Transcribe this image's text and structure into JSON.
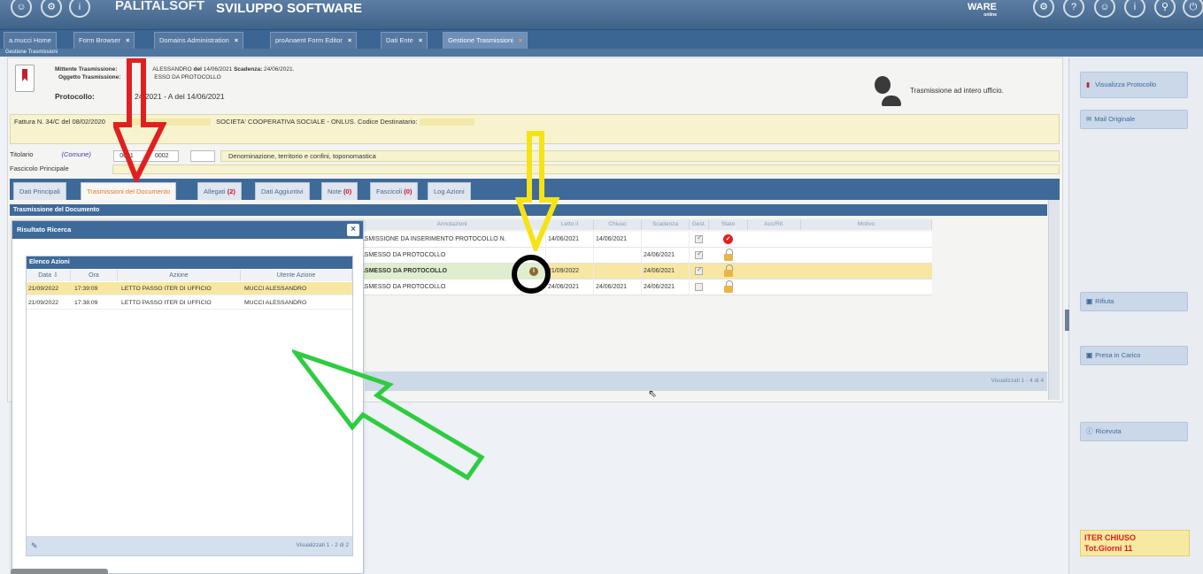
{
  "header": {
    "app_name": "SVILUPPO SOFTWARE",
    "app_name_left": "PALITALSOFT",
    "logo": "WARE",
    "logo_sub": "online"
  },
  "tabs": [
    {
      "label": "a.mucci Home",
      "closable": false
    },
    {
      "label": "Form Browser",
      "closable": true
    },
    {
      "label": "Domains Administration",
      "closable": true
    },
    {
      "label": "proAnaent Form Editor",
      "closable": true
    },
    {
      "label": "Dati Ente",
      "closable": true
    },
    {
      "label": "Gestione Trasmissioni",
      "closable": true,
      "active": true
    }
  ],
  "breadcrumb": "Gestione Trasmissioni",
  "document": {
    "mittente_label": "Mittente Trasmissione:",
    "mittente_value": "ALESSANDRO",
    "del_label": "del",
    "del_value": "14/06/2021",
    "scadenza_label": "Scadenza:",
    "scadenza_value": "24/06/2021.",
    "oggetto_label": "Oggetto Trasmissione:",
    "oggetto_value": "ESSO DA PROTOCOLLO",
    "protocollo_label": "Protocollo:",
    "protocollo_value": "24 2021 - A del 14/06/2021",
    "intero_ufficio": "Trasmissione ad intero ufficio.",
    "fattura_a": "Fattura N. 34/C del 08/02/2020",
    "fattura_b": "SOCIETA' COOPERATIVA SOCIALE - ONLUS. Codice Destinatario:",
    "titolario_label": "Titolario",
    "titolario_comune": "(Comune)",
    "titolario_code": "0001",
    "titolario_code2": "0002",
    "titolario_desc": "Denominazione, territorio e confini, toponomastica",
    "fascicolo_label": "Fascicolo Principale"
  },
  "subtabs": [
    {
      "label": "Dati Principali",
      "count": ""
    },
    {
      "label": "Trasmissioni del Documento",
      "count": "",
      "active": true
    },
    {
      "label": "Allegati",
      "count": "(2)"
    },
    {
      "label": "Dati Aggiuntivi",
      "count": ""
    },
    {
      "label": "Note",
      "count": "(0)"
    },
    {
      "label": "Fascicoli",
      "count": "(0)"
    },
    {
      "label": "Log Azioni",
      "count": ""
    }
  ],
  "trasmissioni": {
    "title": "Trasmissione del Documento",
    "columns": [
      "Annotazioni",
      "Letto il",
      "Chiuso",
      "Scadenza",
      "Gest.",
      "Stato",
      "Acc/Rif.",
      "Motivo"
    ],
    "rows": [
      {
        "annotazioni": "ASMISSIONE DA INSERIMENTO PROTOCOLLO N.",
        "letto": "14/06/2021",
        "chiuso": "14/06/2021",
        "scadenza": "",
        "gest": true,
        "stato": "ok"
      },
      {
        "annotazioni": "ASMESSO DA PROTOCOLLO",
        "letto": "",
        "chiuso": "",
        "scadenza": "24/06/2021",
        "gest": true,
        "stato": "lock"
      },
      {
        "annotazioni": "ASMESSO DA PROTOCOLLO",
        "letto": "21/09/2022",
        "chiuso": "",
        "scadenza": "24/06/2021",
        "gest": true,
        "stato": "lock",
        "selected": true
      },
      {
        "annotazioni": "ASMESSO DA PROTOCOLLO",
        "letto": "24/06/2021",
        "chiuso": "24/06/2021",
        "scadenza": "24/06/2021",
        "gest": false,
        "stato": "lock"
      }
    ],
    "footer": "Visualizzati 1 - 4 di 4"
  },
  "modal": {
    "title": "Risultato Ricerca",
    "close": "×",
    "list_title": "Elenco Azioni",
    "columns": [
      "Data ⇩",
      "Ora",
      "Azione",
      "Utente Azione"
    ],
    "rows": [
      {
        "data": "21/09/2022",
        "ora": "17:39:09",
        "azione": "LETTO PASSO ITER DI UFFICIO",
        "utente": "MUCCI ALESSANDRO",
        "selected": true
      },
      {
        "data": "21/09/2022",
        "ora": "17:38:09",
        "azione": "LETTO PASSO ITER DI UFFICIO",
        "utente": "MUCCI ALESSANDRO"
      }
    ],
    "footer": "Visualizzati 1 - 2 di 2"
  },
  "sidebar": {
    "visualizza": "Visualizza Protocollo",
    "mail": "Mail Originale",
    "rifiuta": "Rifiuta",
    "presa": "Presa in Carico",
    "ricevuta": "Ricevuta",
    "iter_line1": "ITER CHIUSO",
    "iter_line2": "Tot.Giorni 11"
  },
  "colors": {
    "header_blue": "#3e6a9a",
    "selected_row": "#f7e7a2",
    "annotation_red": "#e02020",
    "annotation_yellow": "#f5e316",
    "annotation_green": "#2ecc40"
  }
}
